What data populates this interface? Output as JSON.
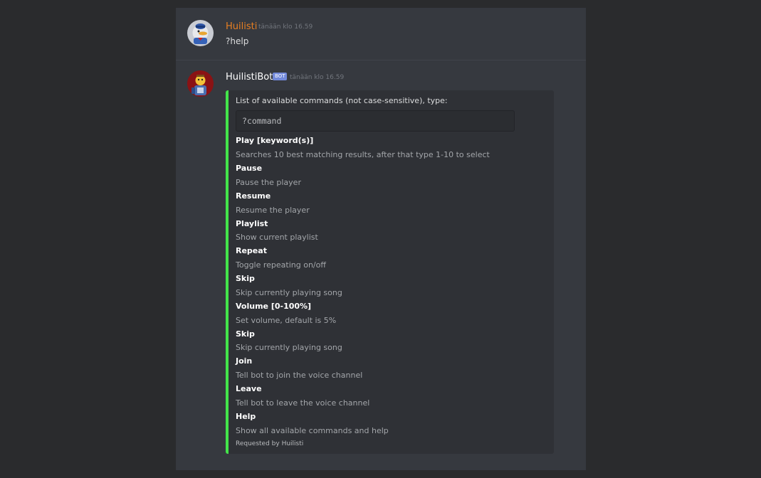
{
  "messages": [
    {
      "author": "Huilisti",
      "author_color": "#e67e22",
      "timestamp": "tänään klo 16.59",
      "text": "?help",
      "avatar_icon": "duck-avatar-icon"
    },
    {
      "author": "HuilistiBot",
      "author_color": "#ffffff",
      "bot_tag": "BOT",
      "timestamp": "tänään klo 16.59",
      "avatar_icon": "bot-avatar-icon",
      "embed": {
        "accent_color": "#43e54a",
        "description": "List of available commands (not case-sensitive), type:",
        "code": "?command",
        "fields": [
          {
            "name": "Play [keyword(s)]",
            "value": "Searches 10 best matching results, after that type 1-10 to select"
          },
          {
            "name": "Pause",
            "value": "Pause the player"
          },
          {
            "name": "Resume",
            "value": "Resume the player"
          },
          {
            "name": "Playlist",
            "value": "Show current playlist"
          },
          {
            "name": "Repeat",
            "value": "Toggle repeating on/off"
          },
          {
            "name": "Skip",
            "value": "Skip currently playing song"
          },
          {
            "name": "Volume [0-100%]",
            "value": "Set volume, default is 5%"
          },
          {
            "name": "Skip",
            "value": "Skip currently playing song"
          },
          {
            "name": "Join",
            "value": "Tell bot to join the voice channel"
          },
          {
            "name": "Leave",
            "value": "Tell bot to leave the voice channel"
          },
          {
            "name": "Help",
            "value": "Show all available commands and help"
          }
        ],
        "footer": "Requested by Huilisti"
      }
    }
  ]
}
